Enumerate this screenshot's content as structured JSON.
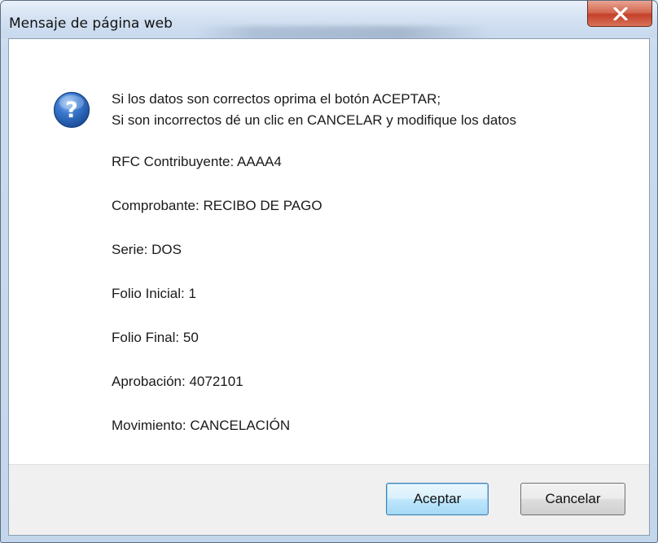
{
  "window": {
    "title": "Mensaje de página web",
    "close_icon": "close-x-icon"
  },
  "message": {
    "icon": "question-icon",
    "line1": "Si los datos son correctos oprima el botón ACEPTAR;",
    "line2": "Si son incorrectos dé un clic en CANCELAR y modifique los datos"
  },
  "fields": [
    {
      "label": "RFC Contribuyente:",
      "value": "AAAA4"
    },
    {
      "label": "Comprobante:",
      "value": "RECIBO DE PAGO"
    },
    {
      "label": "Serie:",
      "value": "DOS"
    },
    {
      "label": "Folio Inicial:",
      "value": "1"
    },
    {
      "label": "Folio Final:",
      "value": "50"
    },
    {
      "label": "Aprobación:",
      "value": "4072101"
    },
    {
      "label": "Movimiento:",
      "value": "CANCELACIÓN"
    }
  ],
  "buttons": {
    "accept": "Aceptar",
    "cancel": "Cancelar"
  },
  "colors": {
    "close_button": "#c4412a",
    "icon_blue": "#2a64b8",
    "default_button_border": "#3c7fb1"
  }
}
